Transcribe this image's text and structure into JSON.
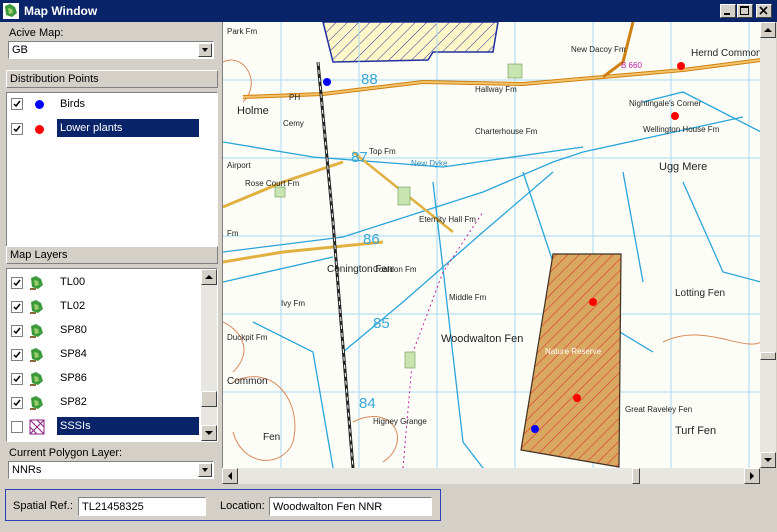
{
  "window": {
    "title": "Map Window"
  },
  "active_map": {
    "label": "Acive Map:",
    "value": "GB"
  },
  "distribution_points": {
    "header": "Distribution Points",
    "items": [
      {
        "label": "Birds",
        "checked": true,
        "color": "#0000ff",
        "selected": false
      },
      {
        "label": "Lower plants",
        "checked": true,
        "color": "#ff0000",
        "selected": true
      }
    ]
  },
  "map_layers": {
    "header": "Map Layers",
    "items": [
      {
        "label": "TL00",
        "checked": true,
        "icon": "raster-map-icon",
        "selected": false
      },
      {
        "label": "TL02",
        "checked": true,
        "icon": "raster-map-icon",
        "selected": false
      },
      {
        "label": "SP80",
        "checked": true,
        "icon": "raster-map-icon",
        "selected": false
      },
      {
        "label": "SP84",
        "checked": true,
        "icon": "raster-map-icon",
        "selected": false
      },
      {
        "label": "SP86",
        "checked": true,
        "icon": "raster-map-icon",
        "selected": false
      },
      {
        "label": "SP82",
        "checked": true,
        "icon": "raster-map-icon",
        "selected": false
      },
      {
        "label": "SSSIs",
        "checked": false,
        "icon": "polygon-layer-icon",
        "selected": true
      }
    ]
  },
  "polygon_layer": {
    "label": "Current Polygon Layer:",
    "value": "NNRs"
  },
  "status": {
    "spatial_ref_label": "Spatial Ref.:",
    "spatial_ref_value": "TL21458325",
    "location_label": "Location:",
    "location_value": "Woodwalton Fen NNR"
  },
  "map": {
    "grid_numbers": [
      "88",
      "87",
      "86",
      "85",
      "84"
    ],
    "places": [
      "Park Fm",
      "Holme",
      "Cemy",
      "PH",
      "Airport",
      "Rose Court Fm",
      "Top Fm",
      "New Dyke",
      "Charterhouse Fm",
      "Hallway Fm",
      "New Dacoy Fm",
      "B 660",
      "Hernd Common",
      "Nightingale's Corner",
      "Wellington House Fm",
      "Ugg Mere",
      "Eternity Hall Fm",
      "Conington Fen",
      "Coaldon Fm",
      "Middle Fm",
      "Nature Reserve",
      "Woodwalton Fen",
      "Lotting Fen",
      "Ivy Fm",
      "Duckpit Fm",
      "Common",
      "Higney Grange",
      "Turf Fen",
      "Great Raveley Fen",
      "Fm",
      "Fen"
    ]
  }
}
